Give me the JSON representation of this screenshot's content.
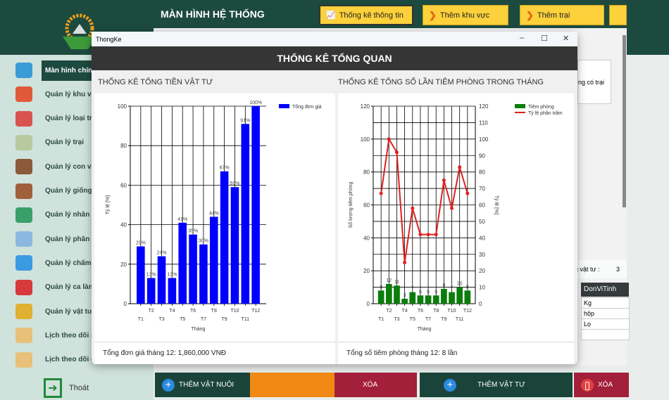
{
  "app": {
    "title": "MÀN HÌNH HỆ THỐNG",
    "top_buttons": [
      {
        "label": "Thống kê thông tin",
        "icon": "chart-icon"
      },
      {
        "label": "Thêm khu vực",
        "icon": "chevron-down-icon"
      },
      {
        "label": "Thêm trại",
        "icon": "chevron-down-icon"
      }
    ]
  },
  "sidebar": {
    "items": [
      {
        "label": "Màn hình chính",
        "icon": "monitor-icon",
        "color": "#3a9bd6",
        "active": true
      },
      {
        "label": "Quản lý khu vực",
        "icon": "location-pin-icon",
        "color": "#e05a3a"
      },
      {
        "label": "Quản lý loại trại",
        "icon": "barn-icon",
        "color": "#d9534f"
      },
      {
        "label": "Quản lý trại",
        "icon": "house-icon",
        "color": "#b8c9a0"
      },
      {
        "label": "Quản lý con vật",
        "icon": "paw-icon",
        "color": "#8a5a3a"
      },
      {
        "label": "Quản lý giống loài",
        "icon": "animals-icon",
        "color": "#a0603a"
      },
      {
        "label": "Quản lý nhân viên",
        "icon": "user-icon",
        "color": "#3aa06a"
      },
      {
        "label": "Quản lý phân quyền",
        "icon": "security-icon",
        "color": "#8ab8e0"
      },
      {
        "label": "Quản lý chấm công",
        "icon": "notepad-icon",
        "color": "#3a9be0"
      },
      {
        "label": "Quản lý ca làm",
        "icon": "alarm-clock-icon",
        "color": "#d63a3a"
      },
      {
        "label": "Quản lý vật tư",
        "icon": "warehouse-icon",
        "color": "#e0b030"
      },
      {
        "label": "Lịch theo dõi sức khỏe",
        "icon": "calendar-icon",
        "color": "#e8c07a"
      },
      {
        "label": "Lịch theo dõi dinh dưỡng",
        "icon": "calendar-icon",
        "color": "#e8c07a"
      }
    ],
    "exit_label": "Thoát"
  },
  "main": {
    "farm_text": "ng có trại",
    "supply_count_label": "g vật tư :",
    "supply_count": "3",
    "table": {
      "header": "DonViTinh",
      "rows": [
        "Kg",
        "hộp",
        "Lọ",
        ""
      ]
    },
    "buttons": {
      "add_animal": "THÊM VẬT NUÔI",
      "delete1": "XÓA",
      "add_supply": "THÊM VẬT TƯ",
      "delete2": "XÓA"
    }
  },
  "modal": {
    "window_title": "ThongKe",
    "header": "THỐNG KÊ TỔNG QUAN",
    "left_title": "THỐNG KÊ TỔNG TIỀN VẬT TƯ",
    "right_title": "THỐNG KÊ TỔNG SỐ LẦN TIÊM PHÒNG TRONG THÁNG",
    "left_footer": "Tổng đơn giá tháng 12: 1,860,000 VNĐ",
    "right_footer": "Tổng số tiêm phòng tháng 12: 8 lần"
  },
  "chart_data": [
    {
      "type": "bar",
      "categories": [
        "T1",
        "T2",
        "T3",
        "T4",
        "T5",
        "T6",
        "T7",
        "T8",
        "T9",
        "T10",
        "T11",
        "T12"
      ],
      "series": [
        {
          "name": "Tổng đơn giá",
          "values": [
            29,
            13,
            24,
            13,
            41,
            35,
            30,
            44,
            67,
            59,
            91,
            100
          ],
          "color": "#0000ff"
        }
      ],
      "data_labels": [
        "29%",
        "13%",
        "24%",
        "13%",
        "41%",
        "35%",
        "30%",
        "44%",
        "67%",
        "59%",
        "91%",
        "100%"
      ],
      "xlabel": "Tháng",
      "ylabel": "Tỷ lệ [%]",
      "ylim": [
        0,
        100
      ],
      "yticks": [
        0,
        20,
        40,
        60,
        80,
        100
      ],
      "grid": true,
      "legend": "top-right"
    },
    {
      "type": "bar+line",
      "categories": [
        "T1",
        "T2",
        "T3",
        "T4",
        "T5",
        "T6",
        "T7",
        "T8",
        "T9",
        "T10",
        "T11",
        "T12"
      ],
      "series": [
        {
          "name": "Tiêm phòng",
          "values": [
            8,
            12,
            11,
            3,
            7,
            5,
            5,
            5,
            9,
            7,
            10,
            8
          ],
          "color": "#0a7d0a",
          "axis": "left"
        },
        {
          "name": "Tỷ lệ phần trăm",
          "values": [
            67,
            100,
            92,
            25,
            58,
            42,
            42,
            42,
            75,
            58,
            83,
            67
          ],
          "color": "#e02020",
          "axis": "right"
        }
      ],
      "xlabel": "Tháng",
      "ylabel": "Số lượng tiêm phòng",
      "y2label": "Tỷ lệ [%]",
      "ylim": [
        0,
        120
      ],
      "y2lim": [
        0,
        120
      ],
      "yticks": [
        0,
        20,
        40,
        60,
        80,
        100,
        120
      ],
      "y2ticks": [
        0,
        10,
        20,
        30,
        40,
        50,
        60,
        70,
        80,
        90,
        100,
        110,
        120
      ],
      "grid": true,
      "legend": "top-right"
    }
  ]
}
